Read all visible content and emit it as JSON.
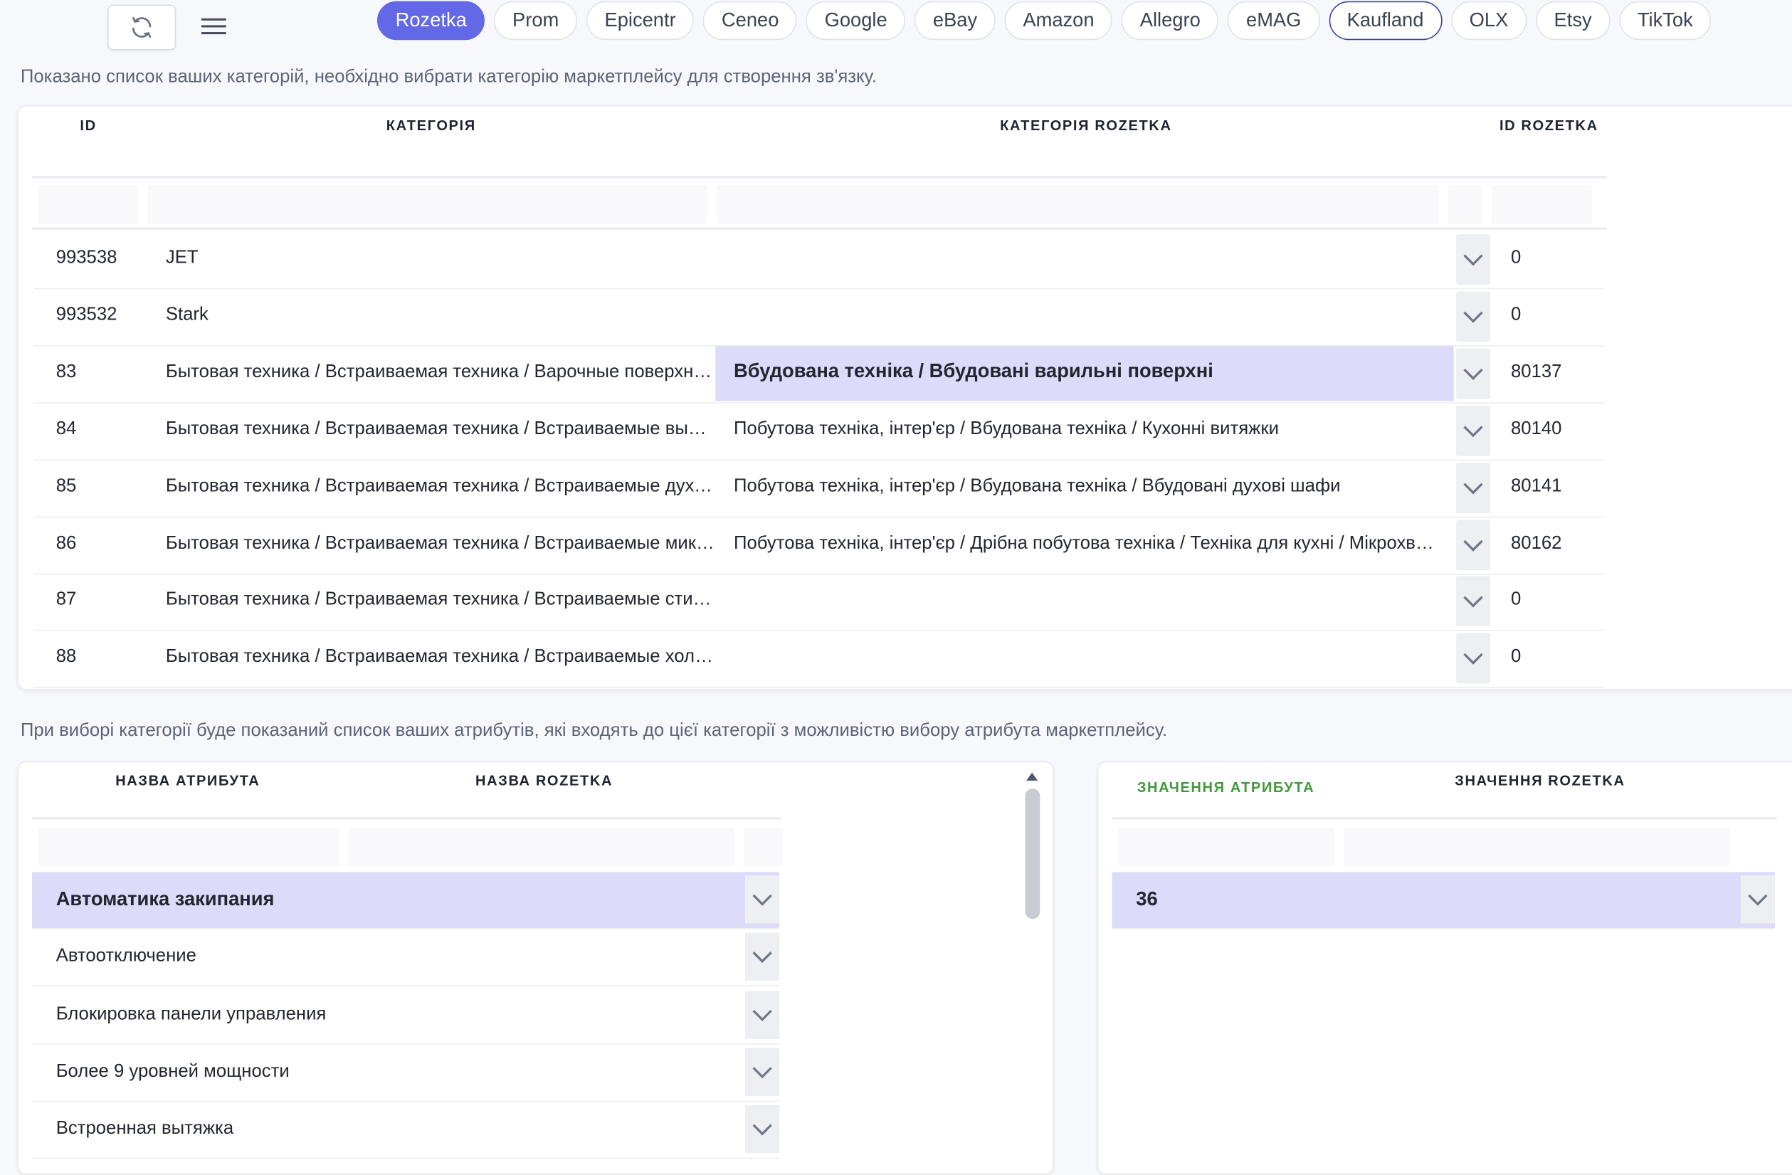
{
  "toolbar": {
    "refresh_icon": "refresh-icon",
    "menu_icon": "hamburger-icon",
    "tabs": [
      {
        "label": "Rozetka",
        "state": "active"
      },
      {
        "label": "Prom",
        "state": ""
      },
      {
        "label": "Epicentr",
        "state": ""
      },
      {
        "label": "Ceneo",
        "state": ""
      },
      {
        "label": "Google",
        "state": ""
      },
      {
        "label": "eBay",
        "state": ""
      },
      {
        "label": "Amazon",
        "state": ""
      },
      {
        "label": "Allegro",
        "state": ""
      },
      {
        "label": "eMAG",
        "state": ""
      },
      {
        "label": "Kaufland",
        "state": "focused"
      },
      {
        "label": "OLX",
        "state": ""
      },
      {
        "label": "Etsy",
        "state": ""
      },
      {
        "label": "TikTok",
        "state": ""
      }
    ]
  },
  "categories": {
    "hint": "Показано список ваших категорій, необхідно вибрати категорію маркетплейсу для створення зв'язку.",
    "headers": {
      "id": "ID",
      "category": "КАТЕГОРІЯ",
      "marketplace_category": "КАТЕГОРІЯ ROZETKA",
      "marketplace_id": "ID ROZETKA"
    },
    "rows": [
      {
        "id": "993538",
        "name": "JET",
        "rozetka": "",
        "rozetka_id": "0",
        "selected": false
      },
      {
        "id": "993532",
        "name": "Stark",
        "rozetka": "",
        "rozetka_id": "0",
        "selected": false
      },
      {
        "id": "83",
        "name": "Бытовая техника / Встраиваемая техника / Варочные поверхнос...",
        "rozetka": "Вбудована техніка / Вбудовані варильні поверхні",
        "rozetka_id": "80137",
        "selected": true
      },
      {
        "id": "84",
        "name": "Бытовая техника / Встраиваемая техника / Встраиваемые вытя...",
        "rozetka": "Побутова техніка, інтер'єр / Вбудована техніка / Кухонні витяжки",
        "rozetka_id": "80140",
        "selected": false
      },
      {
        "id": "85",
        "name": "Бытовая техника / Встраиваемая техника / Встраиваемые духов...",
        "rozetka": "Побутова техніка, інтер'єр / Вбудована техніка / Вбудовані духові шафи",
        "rozetka_id": "80141",
        "selected": false
      },
      {
        "id": "86",
        "name": "Бытовая техника / Встраиваемая техника / Встраиваемые микр...",
        "rozetka": "Побутова техніка, інтер'єр / Дрібна побутова техніка / Техніка для кухні / Мікрохвиль...",
        "rozetka_id": "80162",
        "selected": false
      },
      {
        "id": "87",
        "name": "Бытовая техника / Встраиваемая техника / Встраиваемые стира...",
        "rozetka": "",
        "rozetka_id": "0",
        "selected": false
      },
      {
        "id": "88",
        "name": "Бытовая техника / Встраиваемая техника / Встраиваемые холод...",
        "rozetka": "",
        "rozetka_id": "0",
        "selected": false
      }
    ]
  },
  "attributes": {
    "hint": "При виборі категорії буде показаний список ваших атрибутів, які входять до цієї категорії з можливістю вибору атрибута маркетплейсу.",
    "headers": {
      "name": "НАЗВА АТРИБУТА",
      "marketplace_name": "НАЗВА ROZETKA"
    },
    "rows": [
      {
        "name": "Автоматика закипания",
        "selected": true
      },
      {
        "name": "Автоотключение",
        "selected": false
      },
      {
        "name": "Блокировка панели управления",
        "selected": false
      },
      {
        "name": "Более 9 уровней мощности",
        "selected": false
      },
      {
        "name": "Встроенная вытяжка",
        "selected": false
      }
    ]
  },
  "values": {
    "headers": {
      "value": "ЗНАЧЕННЯ АТРИБУТА",
      "marketplace_value": "ЗНАЧЕННЯ ROZETKA"
    },
    "rows": [
      {
        "value": "36",
        "selected": true
      }
    ]
  }
}
